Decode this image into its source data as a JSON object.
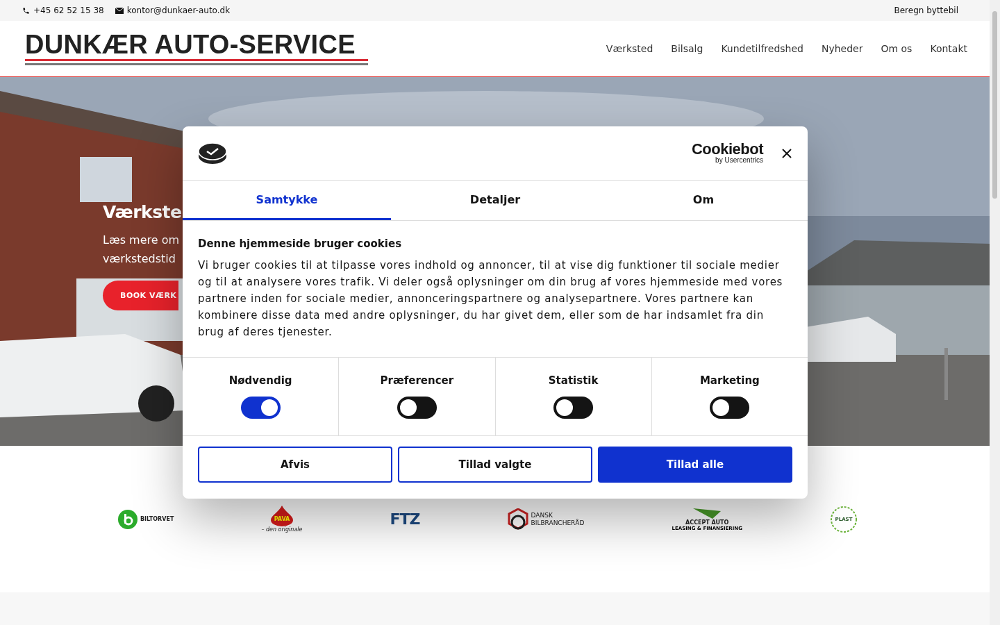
{
  "top_bar": {
    "phone": "+45 62 52 15 38",
    "email": "kontor@dunkaer-auto.dk",
    "link": "Beregn byttebil"
  },
  "header": {
    "logo": "DUNKÆR AUTO-SERVICE",
    "nav": [
      "Værksted",
      "Bilsalg",
      "Kundetilfredshed",
      "Nyheder",
      "Om os",
      "Kontakt"
    ]
  },
  "hero": {
    "title": "Værkste",
    "lines": [
      "Læs mere om",
      "værkstedstid"
    ],
    "button": "BOOK VÆRK"
  },
  "cookie_dialog": {
    "brand": "Cookiebot",
    "brand_sub": "by Usercentrics",
    "tabs": [
      {
        "label": "Samtykke",
        "selected": true
      },
      {
        "label": "Detaljer",
        "selected": false
      },
      {
        "label": "Om",
        "selected": false
      }
    ],
    "heading": "Denne hjemmeside bruger cookies",
    "text": "Vi bruger cookies til at tilpasse vores indhold og annoncer, til at vise dig funktioner til sociale medier og til at analysere vores trafik. Vi deler også oplysninger om din brug af vores hjemmeside med vores partnere inden for sociale medier, annonceringspartnere og analysepartnere. Vores partnere kan kombinere disse data med andre oplysninger, du har givet dem, eller som de har indsamlet fra din brug af deres tjenester.",
    "categories": [
      {
        "label": "Nødvendig",
        "on": true
      },
      {
        "label": "Præferencer",
        "on": false
      },
      {
        "label": "Statistik",
        "on": false
      },
      {
        "label": "Marketing",
        "on": false
      }
    ],
    "buttons": [
      {
        "label": "Afvis",
        "kind": "outline"
      },
      {
        "label": "Tillad valgte",
        "kind": "outline"
      },
      {
        "label": "Tillad alle",
        "kind": "primary"
      }
    ]
  },
  "partners": [
    {
      "kind": "biltorvet",
      "name": "BILTORVET"
    },
    {
      "kind": "pava",
      "name": "PAVA",
      "tagline": "– den originale"
    },
    {
      "kind": "ftz",
      "name": "FTZ"
    },
    {
      "kind": "dbr",
      "name": "DANSK",
      "tagline": "BILBRANCHERÅD"
    },
    {
      "kind": "accept",
      "name": "ACCEPT AUTO",
      "tagline": "LEASING & FINANSIERING"
    },
    {
      "kind": "plast",
      "name": "PLAST"
    }
  ]
}
